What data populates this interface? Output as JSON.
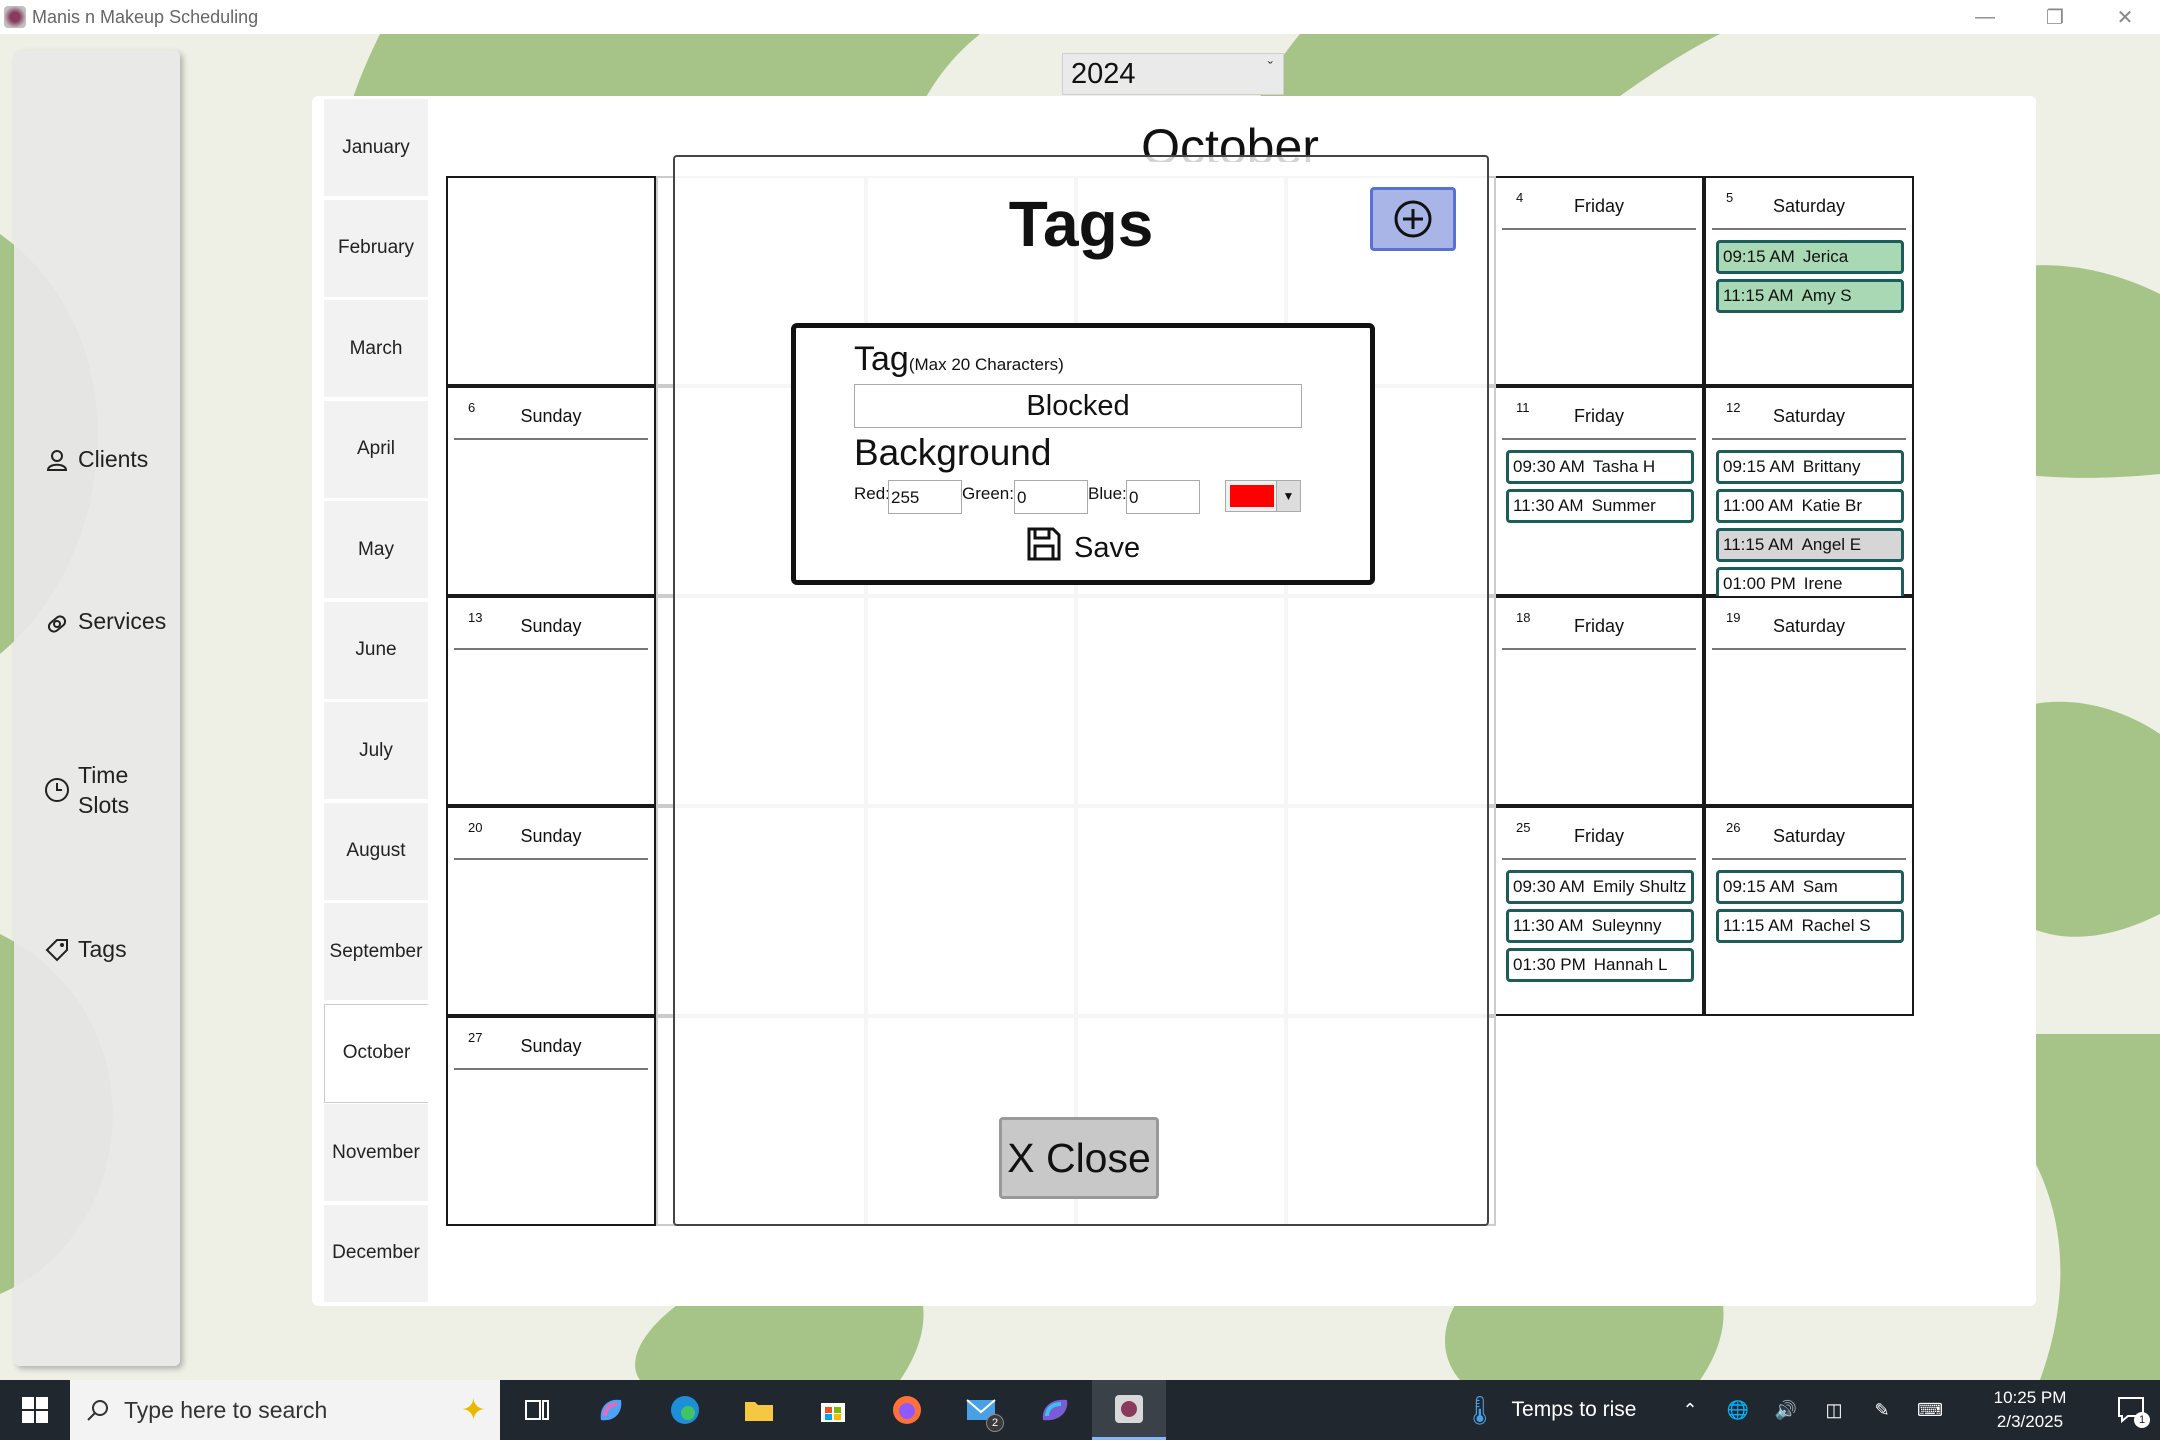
{
  "window": {
    "title": "Manis n Makeup Scheduling"
  },
  "sidebar": {
    "items": [
      {
        "label": "Clients",
        "icon": "person-icon"
      },
      {
        "label": "Services",
        "icon": "nail-polish-icon"
      },
      {
        "label": "Time Slots",
        "label_line1": "Time",
        "label_line2": "Slots",
        "icon": "clock-icon"
      },
      {
        "label": "Tags",
        "icon": "tag-icon"
      }
    ]
  },
  "year_select": {
    "value": "2024"
  },
  "months": [
    "January",
    "February",
    "March",
    "April",
    "May",
    "June",
    "July",
    "August",
    "September",
    "October",
    "November",
    "December"
  ],
  "selected_month": "October",
  "calendar": {
    "month_title": "October",
    "cells": [
      {
        "day": "4",
        "name": "Friday",
        "appts": []
      },
      {
        "day": "5",
        "name": "Saturday",
        "appts": [
          {
            "time": "09:15 AM",
            "client": "Jerica",
            "style": "green"
          },
          {
            "time": "11:15 AM",
            "client": "Amy S",
            "style": "green"
          }
        ]
      },
      {
        "day": "6",
        "name": "Sunday",
        "appts": []
      },
      {
        "day": "11",
        "name": "Friday",
        "appts": [
          {
            "time": "09:30 AM",
            "client": "Tasha H",
            "style": ""
          },
          {
            "time": "11:30 AM",
            "client": "Summer",
            "style": ""
          }
        ]
      },
      {
        "day": "12",
        "name": "Saturday",
        "appts": [
          {
            "time": "09:15 AM",
            "client": "Brittany",
            "style": ""
          },
          {
            "time": "11:00 AM",
            "client": "Katie Br",
            "style": ""
          },
          {
            "time": "11:15 AM",
            "client": "Angel E",
            "style": "grey"
          },
          {
            "time": "01:00 PM",
            "client": "Irene",
            "style": ""
          }
        ]
      },
      {
        "day": "13",
        "name": "Sunday",
        "appts": []
      },
      {
        "day": "18",
        "name": "Friday",
        "appts": []
      },
      {
        "day": "19",
        "name": "Saturday",
        "appts": []
      },
      {
        "day": "20",
        "name": "Sunday",
        "appts": []
      },
      {
        "day": "25",
        "name": "Friday",
        "appts": [
          {
            "time": "09:30 AM",
            "client": "Emily Shultz",
            "style": ""
          },
          {
            "time": "11:30 AM",
            "client": "Suleynny",
            "style": ""
          },
          {
            "time": "01:30 PM",
            "client": "Hannah L",
            "style": ""
          }
        ]
      },
      {
        "day": "26",
        "name": "Saturday",
        "appts": [
          {
            "time": "09:15 AM",
            "client": "Sam",
            "style": ""
          },
          {
            "time": "11:15 AM",
            "client": "Rachel S",
            "style": ""
          }
        ]
      },
      {
        "day": "27",
        "name": "Sunday",
        "appts": []
      }
    ]
  },
  "tags_dialog": {
    "title": "Tags",
    "tag_label": "Tag",
    "tag_hint": "(Max 20 Characters)",
    "tag_value": "Blocked",
    "background_label": "Background",
    "red_label": "Red:",
    "red_value": "255",
    "green_label": "Green:",
    "green_value": "0",
    "blue_label": "Blue:",
    "blue_value": "0",
    "swatch_color": "#ff0000",
    "save_label": "Save",
    "close_label": "X Close"
  },
  "taskbar": {
    "search_placeholder": "Type here to search",
    "mail_badge": "2",
    "weather_text": "Temps to rise",
    "time": "10:25 PM",
    "date": "2/3/2025",
    "notification_count": "1"
  },
  "colors": {
    "appt_border": "#1c5c5a",
    "appt_green": "#a9d9b4",
    "add_button": "#a9b5e6",
    "background_green": "#a6c488"
  }
}
